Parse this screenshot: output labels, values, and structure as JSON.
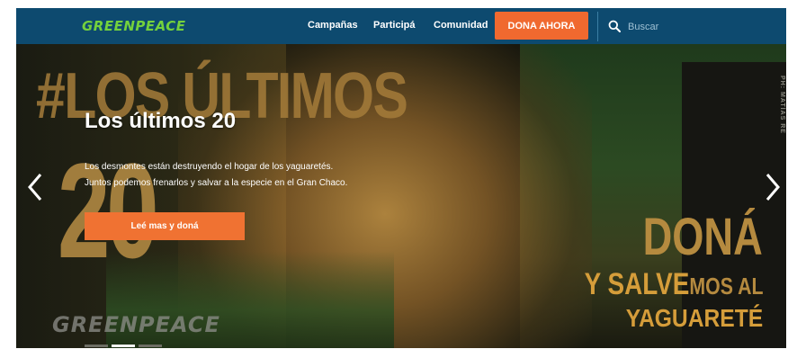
{
  "header": {
    "logo": "GREENPEACE",
    "nav": [
      "Campañas",
      "Participá",
      "Comunidad"
    ],
    "donate_label": "DONA AHORA",
    "search_placeholder": "Buscar"
  },
  "hero": {
    "hashtag": "#LOS ÚLTIMOS",
    "big_number": "20",
    "title": "Los últimos 20",
    "description": "Los desmontes están destruyendo el hogar de los yaguaretés. Juntos podemos frenarlos y salvar a la especie en el Gran Chaco.",
    "cta_label": "Leé mas y doná",
    "side_text": "PH: MATÍAS RE",
    "dona_line1": "DONÁ",
    "dona_line2_a": "Y SALVE",
    "dona_line2_b": "MOS AL",
    "dona_line3": "YAGUARETÉ",
    "watermark": "GREENPEACE",
    "slide_indicators": 3,
    "active_slide": 1
  },
  "colors": {
    "header_bg": "#0d4a6f",
    "brand_green": "#74d13c",
    "accent_orange": "#f0692f",
    "gold": "#b58a3f"
  },
  "icons": [
    "search-icon",
    "chevron-left-icon",
    "chevron-right-icon"
  ]
}
